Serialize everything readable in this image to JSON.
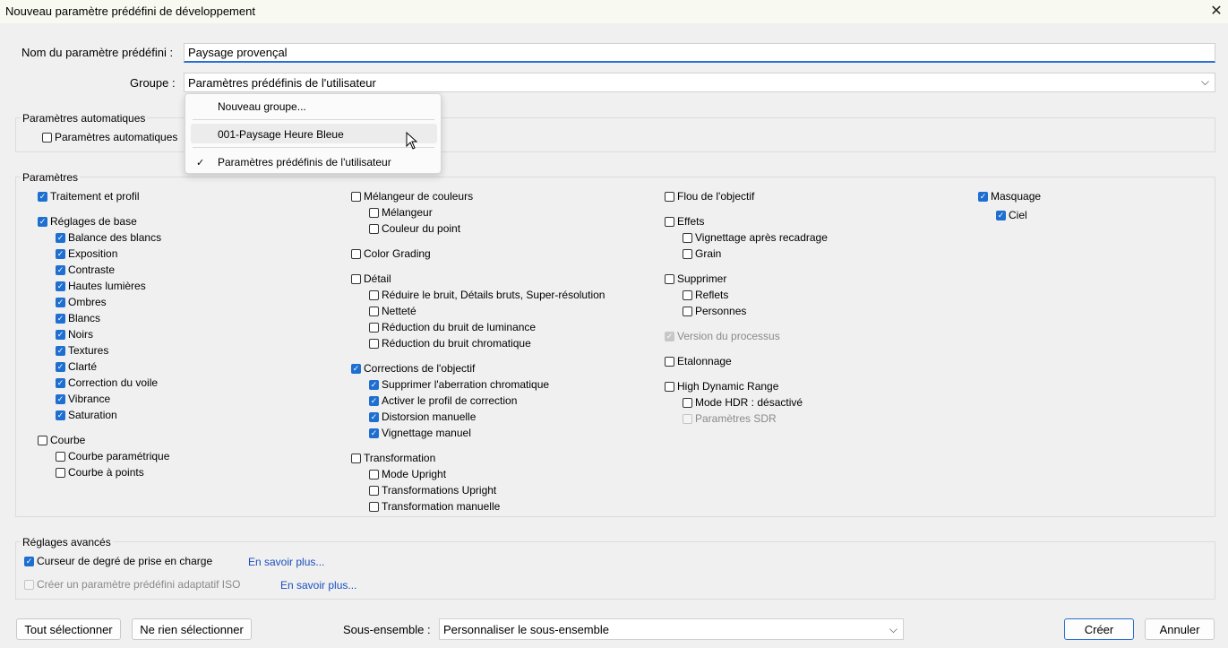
{
  "window": {
    "title": "Nouveau paramètre prédéfini de développement"
  },
  "form": {
    "name_label": "Nom du paramètre prédéfini :",
    "name_value": "Paysage provençal",
    "group_label": "Groupe :",
    "group_value": "Paramètres prédéfinis de l'utilisateur"
  },
  "group_menu": {
    "items": [
      "Nouveau groupe...",
      "001-Paysage Heure Bleue",
      "Paramètres prédéfinis de l'utilisateur"
    ],
    "selected": "Paramètres prédéfinis de l'utilisateur"
  },
  "auto": {
    "heading": "Paramètres automatiques",
    "checkbox": "Paramètres automatiques"
  },
  "params": {
    "heading": "Paramètres",
    "col1": [
      {
        "label": "Traitement et profil",
        "checked": true
      },
      {
        "label": "Réglages de base",
        "checked": true
      },
      {
        "label": "Balance des blancs",
        "checked": true
      },
      {
        "label": "Exposition",
        "checked": true
      },
      {
        "label": "Contraste",
        "checked": true
      },
      {
        "label": "Hautes lumières",
        "checked": true
      },
      {
        "label": "Ombres",
        "checked": true
      },
      {
        "label": "Blancs",
        "checked": true
      },
      {
        "label": "Noirs",
        "checked": true
      },
      {
        "label": "Textures",
        "checked": true
      },
      {
        "label": "Clarté",
        "checked": true
      },
      {
        "label": "Correction du voile",
        "checked": true
      },
      {
        "label": "Vibrance",
        "checked": true
      },
      {
        "label": "Saturation",
        "checked": true
      },
      {
        "label": "Courbe",
        "checked": false
      },
      {
        "label": "Courbe paramétrique",
        "checked": false
      },
      {
        "label": "Courbe à points",
        "checked": false
      }
    ],
    "col2": [
      {
        "label": "Mélangeur de couleurs",
        "checked": false
      },
      {
        "label": "Mélangeur",
        "checked": false
      },
      {
        "label": "Couleur du point",
        "checked": false
      },
      {
        "label": "Color Grading",
        "checked": false
      },
      {
        "label": "Détail",
        "checked": false
      },
      {
        "label": "Réduire le bruit, Détails bruts, Super-résolution",
        "checked": false
      },
      {
        "label": "Netteté",
        "checked": false
      },
      {
        "label": "Réduction du bruit de luminance",
        "checked": false
      },
      {
        "label": "Réduction du bruit chromatique",
        "checked": false
      },
      {
        "label": "Corrections de l'objectif",
        "checked": true
      },
      {
        "label": "Supprimer l'aberration chromatique",
        "checked": true
      },
      {
        "label": "Activer le profil de correction",
        "checked": true
      },
      {
        "label": "Distorsion manuelle",
        "checked": true
      },
      {
        "label": "Vignettage manuel",
        "checked": true
      },
      {
        "label": "Transformation",
        "checked": false
      },
      {
        "label": "Mode Upright",
        "checked": false
      },
      {
        "label": "Transformations Upright",
        "checked": false
      },
      {
        "label": "Transformation manuelle",
        "checked": false
      }
    ],
    "col3": [
      {
        "label": "Flou de l'objectif",
        "checked": false
      },
      {
        "label": "Effets",
        "checked": false
      },
      {
        "label": "Vignettage après recadrage",
        "checked": false
      },
      {
        "label": "Grain",
        "checked": false
      },
      {
        "label": "Supprimer",
        "checked": false
      },
      {
        "label": "Reflets",
        "checked": false
      },
      {
        "label": "Personnes",
        "checked": false
      },
      {
        "label": "Version du processus",
        "checked": true,
        "disabled": true
      },
      {
        "label": "Etalonnage",
        "checked": false
      },
      {
        "label": "High Dynamic Range",
        "checked": false
      },
      {
        "label": "Mode HDR : désactivé",
        "checked": false
      },
      {
        "label": "Paramètres SDR",
        "checked": false,
        "disabled": true
      }
    ],
    "col4": [
      {
        "label": "Masquage",
        "checked": true
      },
      {
        "label": "Ciel",
        "checked": true
      }
    ]
  },
  "advanced": {
    "heading": "Réglages avancés",
    "item1": "Curseur de degré de prise en charge",
    "item2": "Créer un paramètre prédéfini adaptatif ISO",
    "link1": "En savoir plus...",
    "link2": "En savoir plus..."
  },
  "footer": {
    "select_all": "Tout sélectionner",
    "select_none": "Ne rien sélectionner",
    "subset_label": "Sous-ensemble :",
    "subset_value": "Personnaliser le sous-ensemble",
    "create": "Créer",
    "cancel": "Annuler"
  },
  "colors": {
    "accent": "#1f6fd0",
    "link": "#1a4fc0"
  }
}
